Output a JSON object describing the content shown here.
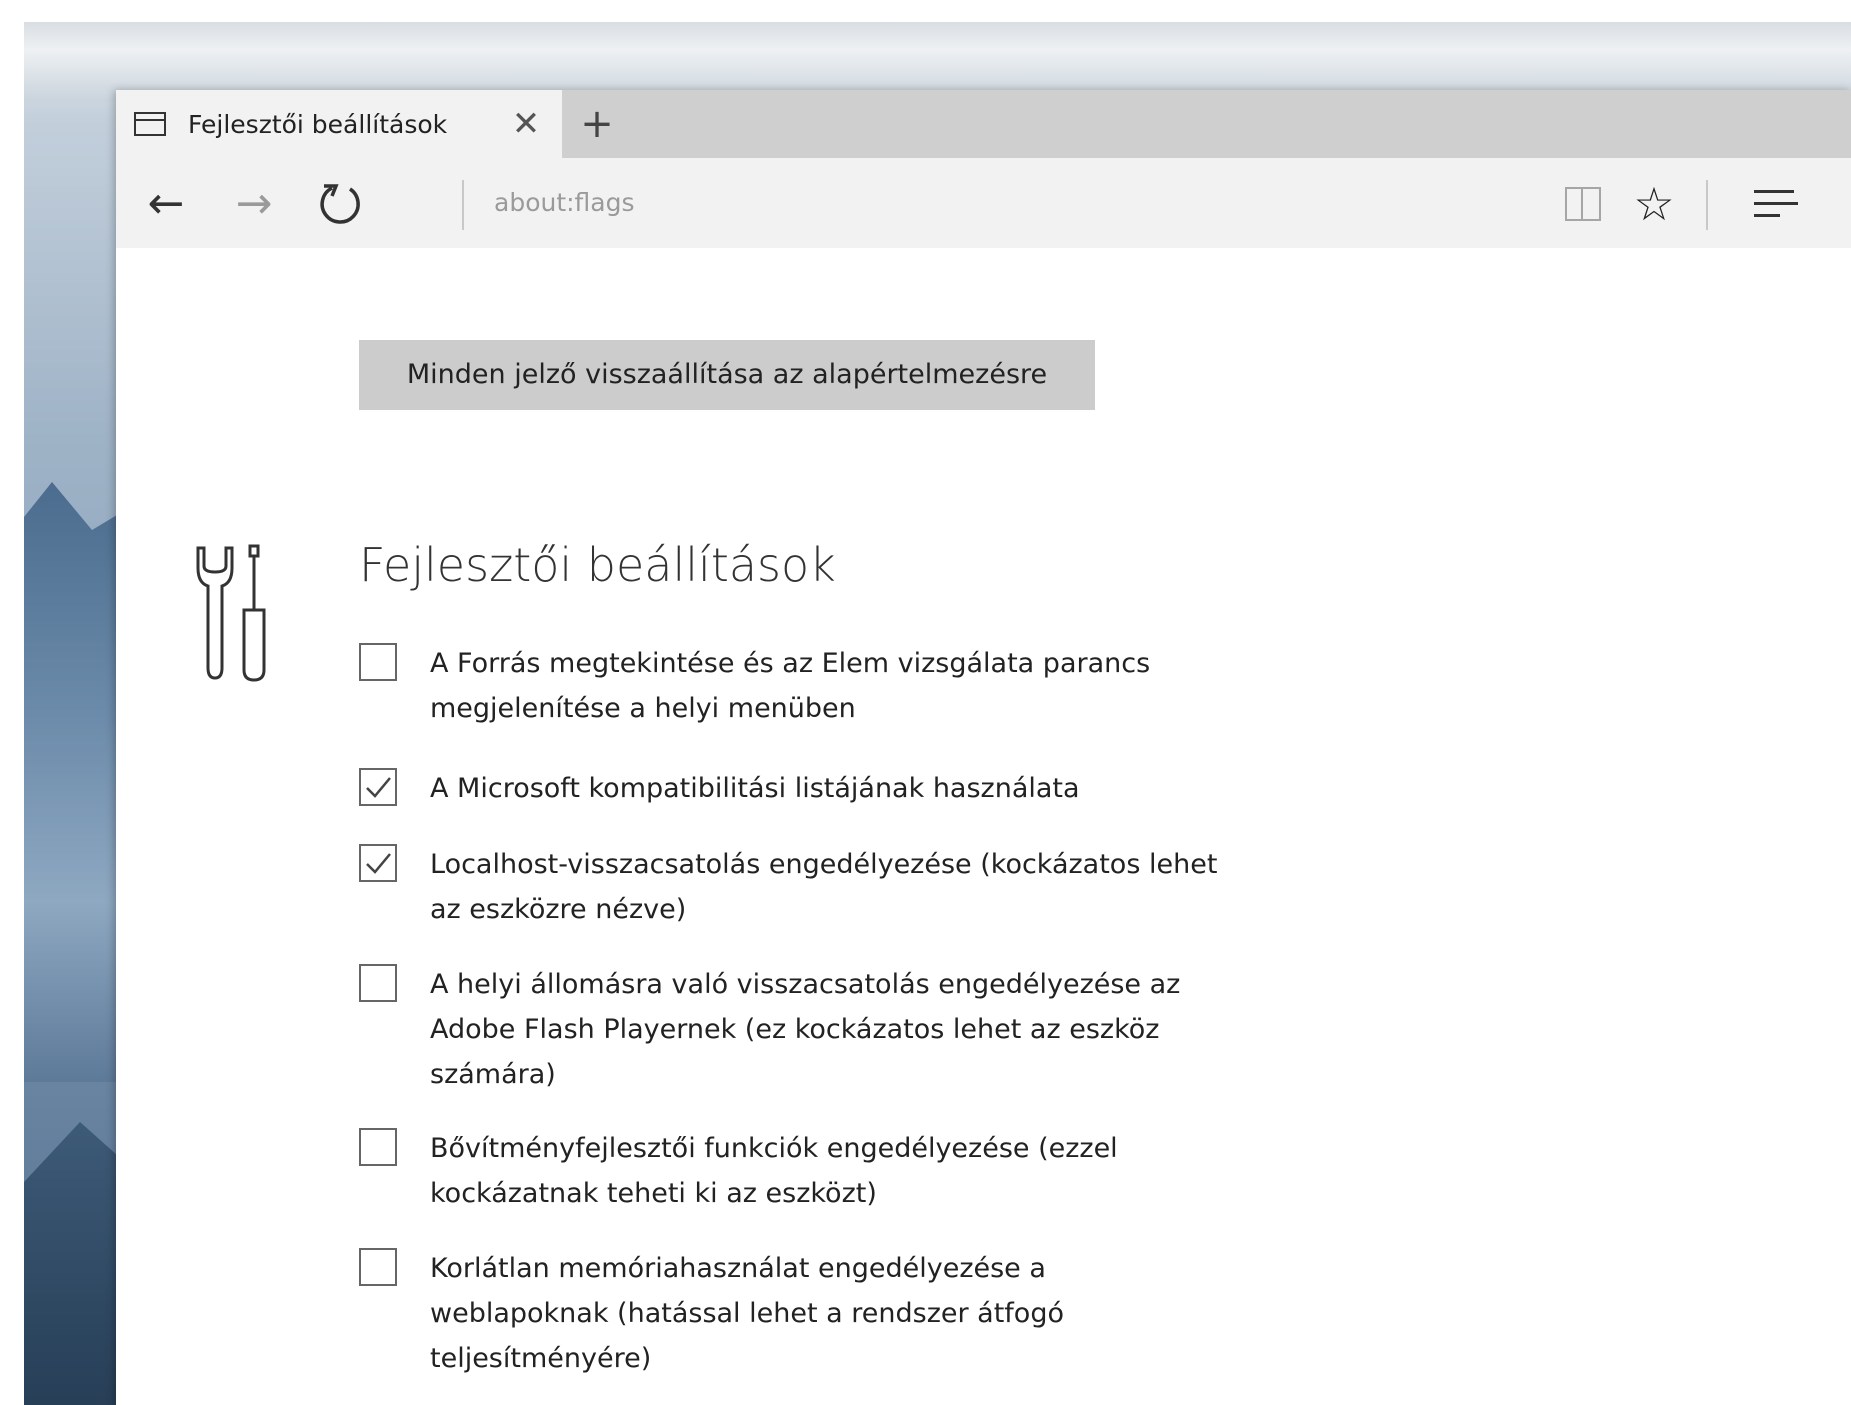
{
  "tab": {
    "title": "Fejlesztői beállítások",
    "close_icon": "close-icon",
    "new_tab_icon": "plus-icon"
  },
  "nav": {
    "back_icon": "arrow-left-icon",
    "forward_icon": "arrow-right-icon",
    "refresh_icon": "refresh-icon",
    "address": "about:flags",
    "reading_view_icon": "reading-view-icon",
    "favorites_icon": "star-icon",
    "hub_icon": "hub-menu-icon"
  },
  "page": {
    "reset_button": "Minden jelző visszaállítása az alapértelmezésre",
    "section_icon": "wrench-screwdriver-icon",
    "section_title": "Fejlesztői beállítások",
    "flags": [
      {
        "label": "A Forrás megtekintése és az Elem vizsgálata parancs megjelenítése a helyi menüben",
        "checked": false
      },
      {
        "label": "A Microsoft kompatibilitási listájának használata",
        "checked": true
      },
      {
        "label": "Localhost-visszacsatolás engedélyezése (kockázatos lehet az eszközre nézve)",
        "checked": true
      },
      {
        "label": "A helyi állomásra való visszacsatolás engedélyezése az Adobe Flash Playernek (ez kockázatos lehet az eszköz számára)",
        "checked": false
      },
      {
        "label": "Bővítményfejlesztői funkciók engedélyezése (ezzel kockázatnak teheti ki az eszközt)",
        "checked": false
      },
      {
        "label": "Korlátlan memóriahasználat engedélyezése a weblapoknak (hatással lehet a rendszer átfogó teljesítményére)",
        "checked": false
      }
    ]
  }
}
